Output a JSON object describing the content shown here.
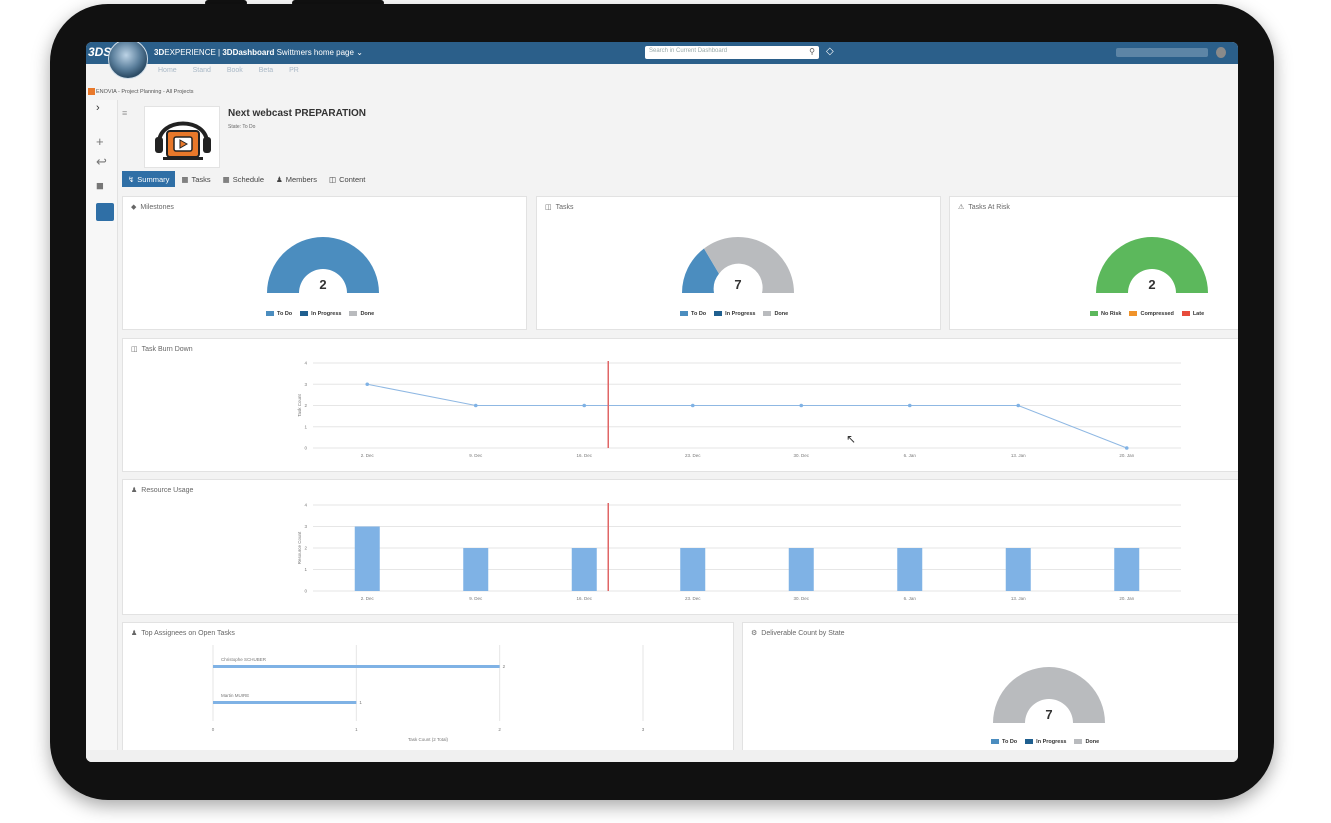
{
  "app": {
    "logo": "3DS",
    "brand_prefix": "3D",
    "brand_experience": "EXPERIENCE",
    "brand_sep": " | ",
    "brand_dash": "3DDashboard",
    "brand_page": " Swittmers home page",
    "submenu": "Home Stand Book Beta PR",
    "search_placeholder": "Search in Current Dashboard",
    "breadcrumb": "ENOVIA - Project Planning - All Projects"
  },
  "project": {
    "title": "Next webcast PREPARATION",
    "state": "State: To Do"
  },
  "tabs": [
    {
      "label": "Summary",
      "icon": "chart-icon"
    },
    {
      "label": "Tasks",
      "icon": "trash-icon"
    },
    {
      "label": "Schedule",
      "icon": "calendar-icon"
    },
    {
      "label": "Members",
      "icon": "people-icon"
    },
    {
      "label": "Content",
      "icon": "document-icon"
    }
  ],
  "colors": {
    "todo": "#4b8dbf",
    "in_progress": "#1f5f8f",
    "done": "#b9bbbe",
    "no_risk": "#5cb85c",
    "compressed": "#f0932b",
    "late": "#e74c3c",
    "accent": "#2f6fa6",
    "line": "#8fb8e3",
    "today": "#e06666"
  },
  "panels": {
    "milestones": {
      "title": "Milestones",
      "center": "2",
      "legend": [
        "To Do",
        "In Progress",
        "Done"
      ]
    },
    "tasks": {
      "title": "Tasks",
      "center": "7",
      "legend": [
        "To Do",
        "In Progress",
        "Done"
      ]
    },
    "risk": {
      "title": "Tasks At Risk",
      "center": "2",
      "legend": [
        "No Risk",
        "Compressed",
        "Late"
      ]
    },
    "burndown": {
      "title": "Task Burn Down"
    },
    "resource": {
      "title": "Resource Usage"
    },
    "assignees": {
      "title": "Top Assignees on Open Tasks"
    },
    "deliverables": {
      "title": "Deliverable Count by State",
      "center": "7",
      "legend": [
        "To Do",
        "In Progress",
        "Done"
      ]
    }
  },
  "chart_data": [
    {
      "type": "pie",
      "title": "Milestones",
      "categories": [
        "To Do",
        "In Progress",
        "Done"
      ],
      "values": [
        2,
        0,
        0
      ]
    },
    {
      "type": "pie",
      "title": "Tasks",
      "categories": [
        "To Do",
        "In Progress",
        "Done"
      ],
      "values": [
        2,
        0,
        5
      ]
    },
    {
      "type": "pie",
      "title": "Tasks At Risk",
      "categories": [
        "No Risk",
        "Compressed",
        "Late"
      ],
      "values": [
        2,
        0,
        0
      ]
    },
    {
      "type": "line",
      "title": "Task Burn Down",
      "ylabel": "Task Count",
      "ylim": [
        0,
        4
      ],
      "yticks": [
        "0",
        "1",
        "2",
        "3",
        "4"
      ],
      "categories": [
        "2. Dec",
        "9. Dec",
        "16. Dec",
        "23. Dec",
        "30. Dec",
        "6. Jan",
        "13. Jan",
        "20. Jan"
      ],
      "values": [
        3,
        2,
        2,
        2,
        2,
        2,
        2,
        0
      ],
      "today_marker": "16. Dec"
    },
    {
      "type": "bar",
      "title": "Resource Usage",
      "ylabel": "Resource Count",
      "ylim": [
        0,
        4
      ],
      "yticks": [
        "0",
        "1",
        "2",
        "3",
        "4"
      ],
      "categories": [
        "2. Dec",
        "9. Dec",
        "16. Dec",
        "23. Dec",
        "30. Dec",
        "6. Jan",
        "13. Jan",
        "20. Jan"
      ],
      "values": [
        3,
        2,
        2,
        2,
        2,
        2,
        2,
        2
      ],
      "today_marker": "16. Dec"
    },
    {
      "type": "bar",
      "title": "Top Assignees on Open Tasks",
      "xlabel": "Task Count (2 Total)",
      "xlim": [
        0,
        3
      ],
      "xticks": [
        "0",
        "1",
        "2",
        "3"
      ],
      "categories": [
        "Christophe SCHUBER",
        "Martin MUIRE"
      ],
      "values": [
        2,
        1
      ],
      "value_labels": [
        "2",
        "1"
      ]
    },
    {
      "type": "pie",
      "title": "Deliverable Count by State",
      "categories": [
        "To Do",
        "In Progress",
        "Done"
      ],
      "values": [
        0,
        0,
        7
      ]
    }
  ]
}
